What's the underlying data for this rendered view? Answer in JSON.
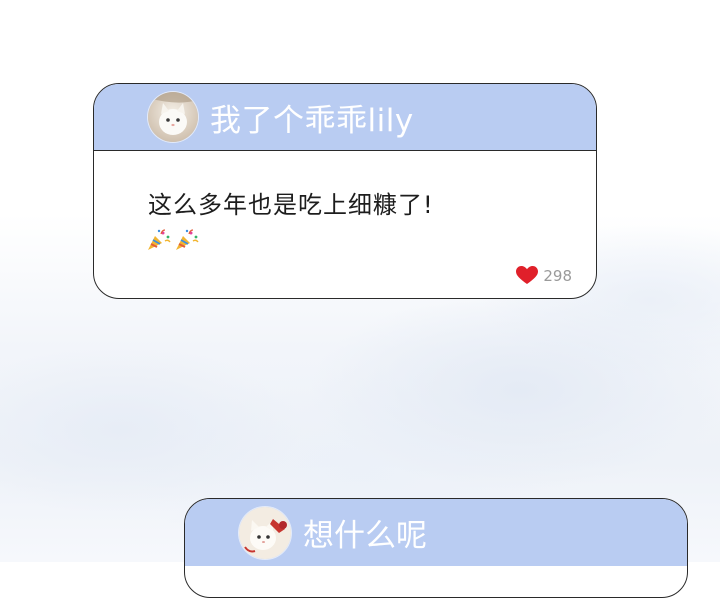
{
  "comments": [
    {
      "username": "我了个乖乖lily",
      "text": "这么多年也是吃上细糠了!",
      "emojis": [
        "party-popper",
        "party-popper"
      ],
      "likes": "298"
    },
    {
      "username": "想什么呢"
    }
  ],
  "colors": {
    "header_bg": "#b9ccf2",
    "username_text": "#ffffff",
    "border": "#2a2a2a",
    "like_heart": "#e0202a",
    "like_count": "#9a9a9a"
  }
}
